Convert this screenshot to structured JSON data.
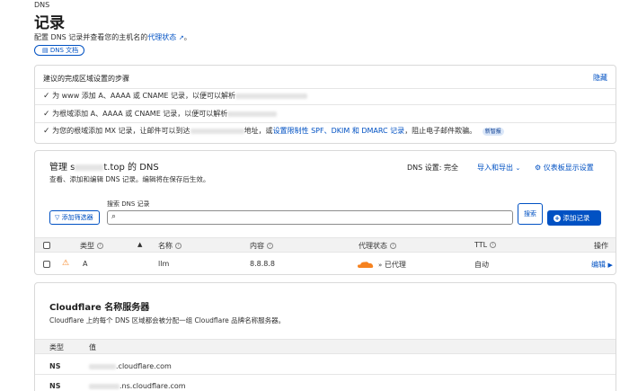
{
  "header": {
    "section": "DNS",
    "title": "记录",
    "description_prefix": "配置 DNS 记录并查看您的主机名的",
    "description_link": "代理状态",
    "doc_button": "DNS 文档"
  },
  "steps": {
    "title": "建议的完成区域设置的步骤",
    "hide": "隐藏",
    "items": [
      {
        "text": "为 www 添加 A、AAAA 或 CNAME 记录，以便可以解析"
      },
      {
        "text": "为根域添加 A、AAAA 或 CNAME 记录，以便可以解析"
      },
      {
        "text_prefix": "为您的根域添加 MX 记录，让邮件可以到达",
        "text_mid": "地址，或",
        "link": "设置限制性 SPF、DKIM 和 DMARC 记录",
        "text_suffix": "，阻止电子邮件欺骗。",
        "badge": "新智报"
      }
    ]
  },
  "manage": {
    "title_prefix": "管理 s",
    "title_suffix": "t.top 的 DNS",
    "subtitle": "查看、添加和编辑 DNS 记录。编辑将在保存后生效。",
    "dns_setting_label": "DNS 设置: 完全",
    "import_export": "导入和导出",
    "dashboard_settings": "仪表板显示设置",
    "add_filter": "添加筛选器",
    "search_label": "搜索 DNS 记录",
    "search_placeholder": "",
    "search_button": "搜索",
    "add_record": "添加记录"
  },
  "table": {
    "headers": {
      "type": "类型",
      "name": "名称",
      "content": "内容",
      "proxy": "代理状态",
      "ttl": "TTL",
      "actions": "操作"
    },
    "rows": [
      {
        "type": "A",
        "name": "llm",
        "content": "8.8.8.8",
        "proxy": "已代理",
        "ttl": "自动",
        "edit": "编辑"
      }
    ]
  },
  "nameservers": {
    "title": "Cloudflare 名称服务器",
    "description": "Cloudflare 上的每个 DNS 区域都会被分配一组 Cloudflare 品牌名称服务器。",
    "headers": {
      "type": "类型",
      "value": "值"
    },
    "rows": [
      {
        "type": "NS",
        "value": ".cloudflare.com"
      },
      {
        "type": "NS",
        "value": ".ns.cloudflare.com"
      }
    ]
  },
  "colors": {
    "accent": "#0051c3",
    "warning": "#f6821f",
    "cloud": "#f6821f"
  }
}
